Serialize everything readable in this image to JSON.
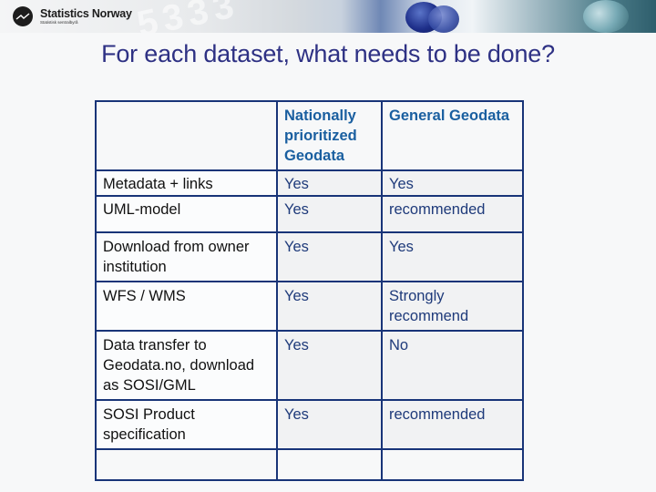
{
  "banner": {
    "logo": {
      "icon": "statistics-norway-logo-icon",
      "name": "Statistics Norway",
      "subtitle": "Statistisk sentralbyrå"
    },
    "decor_digits": "5333"
  },
  "slide": {
    "title": "For each dataset, what needs to be done?"
  },
  "table": {
    "header": [
      "",
      "Nationally prioritized Geodata",
      "General Geodata"
    ],
    "rows": [
      {
        "task": "Metadata + links",
        "national": "Yes",
        "general": "Yes"
      },
      {
        "task": "UML-model",
        "national": "Yes",
        "general": "recommended"
      },
      {
        "task": "Download from owner institution",
        "national": "Yes",
        "general": "Yes"
      },
      {
        "task": "WFS / WMS",
        "national": "Yes",
        "general": "Strongly recommend"
      },
      {
        "task": "Data transfer to Geodata.no, download as SOSI/GML",
        "national": "Yes",
        "general": "No"
      },
      {
        "task": "SOSI Product specification",
        "national": "Yes",
        "general": "recommended"
      },
      {
        "task": "",
        "national": "",
        "general": ""
      }
    ]
  },
  "colors": {
    "title": "#2e3184",
    "header_text": "#1a5fa0",
    "cell_value_text": "#1e3a7a",
    "table_border": "#183478"
  }
}
